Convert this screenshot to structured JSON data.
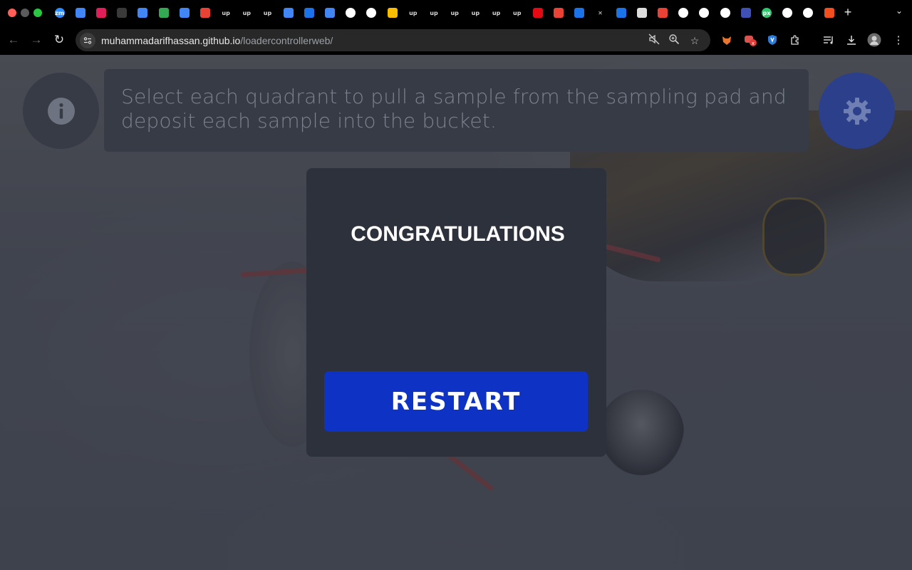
{
  "browser": {
    "url_host": "muhammadarifhassan.github.io",
    "url_path": "/loadercontrollerweb/",
    "tabs": [
      {
        "icon": "zoom-icon",
        "label": "zm",
        "color": "#2d8cff"
      },
      {
        "icon": "google-docs-icon",
        "label": "",
        "color": "#4285f4"
      },
      {
        "icon": "slack-icon",
        "label": "",
        "color": "#e01e5a"
      },
      {
        "icon": "chatgpt-icon",
        "label": "",
        "color": "#3a3a3a"
      },
      {
        "icon": "google-docs-icon",
        "label": "",
        "color": "#4285f4"
      },
      {
        "icon": "google-play-icon",
        "label": "",
        "color": "#34a853"
      },
      {
        "icon": "google-docs-icon",
        "label": "",
        "color": "#4285f4"
      },
      {
        "icon": "gmail-icon",
        "label": "",
        "color": "#ea4335"
      },
      {
        "icon": "upwork-icon",
        "label": "up",
        "color": ""
      },
      {
        "icon": "upwork-icon",
        "label": "up",
        "color": ""
      },
      {
        "icon": "upwork-icon",
        "label": "up",
        "color": ""
      },
      {
        "icon": "google-docs-icon",
        "label": "",
        "color": "#4285f4"
      },
      {
        "icon": "download-icon",
        "label": "",
        "color": "#1a73e8"
      },
      {
        "icon": "google-docs-icon",
        "label": "",
        "color": "#4285f4"
      },
      {
        "icon": "google-icon",
        "label": "",
        "color": "#ffffff"
      },
      {
        "icon": "google-icon",
        "label": "",
        "color": "#ffffff"
      },
      {
        "icon": "google-drive-icon",
        "label": "",
        "color": "#fbbc04"
      },
      {
        "icon": "upwork-icon",
        "label": "up",
        "color": ""
      },
      {
        "icon": "upwork-icon",
        "label": "up",
        "color": ""
      },
      {
        "icon": "upwork-icon",
        "label": "up",
        "color": ""
      },
      {
        "icon": "upwork-icon",
        "label": "up",
        "color": ""
      },
      {
        "icon": "upwork-icon",
        "label": "up",
        "color": ""
      },
      {
        "icon": "upwork-icon",
        "label": "up",
        "color": ""
      },
      {
        "icon": "netflix-icon",
        "label": "",
        "color": "#e50914"
      },
      {
        "icon": "gmail-icon",
        "label": "",
        "color": "#ea4335"
      },
      {
        "icon": "history-icon",
        "label": "",
        "color": "#1a73e8"
      },
      {
        "icon": "close-icon",
        "label": "✕",
        "color": ""
      },
      {
        "icon": "settings-icon",
        "label": "",
        "color": "#1a73e8"
      },
      {
        "icon": "chrome-icon",
        "label": "",
        "color": "#dddddd"
      },
      {
        "icon": "store-icon",
        "label": "",
        "color": "#ea4335"
      },
      {
        "icon": "google-icon",
        "label": "",
        "color": "#ffffff"
      },
      {
        "icon": "google-icon",
        "label": "",
        "color": "#ffffff"
      },
      {
        "icon": "google-icon",
        "label": "",
        "color": "#ffffff"
      },
      {
        "icon": "play-icon",
        "label": "",
        "color": "#3f51b5"
      },
      {
        "icon": "pixabay-icon",
        "label": "px",
        "color": "#2ec66d"
      },
      {
        "icon": "google-icon",
        "label": "",
        "color": "#ffffff"
      },
      {
        "icon": "google-icon",
        "label": "",
        "color": "#ffffff"
      },
      {
        "icon": "figma-icon",
        "label": "",
        "color": "#f24e1e"
      }
    ]
  },
  "page": {
    "instructions": "Select each quadrant to pull a sample from the sampling pad and deposit each sample into the bucket.",
    "modal": {
      "title": "CONGRATULATIONS",
      "restart_label": "RESTART"
    }
  },
  "colors": {
    "panel": "#363b46",
    "modal": "#2c313b",
    "accent": "#0e33c4",
    "settings": "#2b3f8a"
  }
}
